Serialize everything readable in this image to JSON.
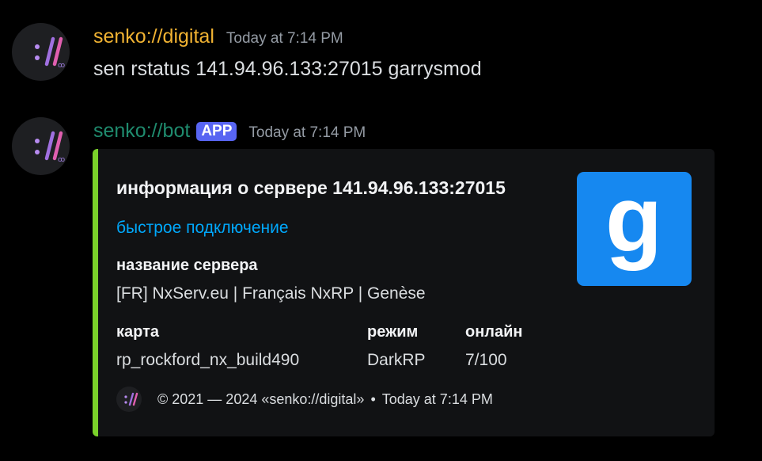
{
  "colors": {
    "user_name": "#f0b232",
    "bot_name": "#1f8b6e",
    "embed_accent": "#7ad12a",
    "link": "#00a8fc",
    "badge": "#5865f2",
    "thumbnail_bg": "#1688f0"
  },
  "messages": [
    {
      "author": "senko://digital",
      "timestamp": "Today at 7:14 PM",
      "avatar_icon": "senko-logo-icon",
      "text": "sen rstatus 141.94.96.133:27015 garrysmod"
    },
    {
      "author": "senko://bot",
      "badge": "APP",
      "timestamp": "Today at 7:14 PM",
      "avatar_icon": "senko-logo-icon",
      "embed": {
        "title": "информация о сервере 141.94.96.133:27015",
        "link_text": "быстрое подключение",
        "thumbnail_icon": "garrysmod-g-icon",
        "thumbnail_letter": "g",
        "fields": {
          "server_name_label": "название сервера",
          "server_name_value": "[FR] NxServ.eu | Français NxRP | Genèse",
          "map_label": "карта",
          "map_value": "rp_rockford_nx_build490",
          "mode_label": "режим",
          "mode_value": "DarkRP",
          "online_label": "онлайн",
          "online_value": "7/100"
        },
        "footer": {
          "icon": "senko-logo-icon",
          "text": "© 2021 — 2024 «senko://digital»",
          "separator": "•",
          "timestamp": "Today at 7:14 PM"
        }
      }
    }
  ]
}
